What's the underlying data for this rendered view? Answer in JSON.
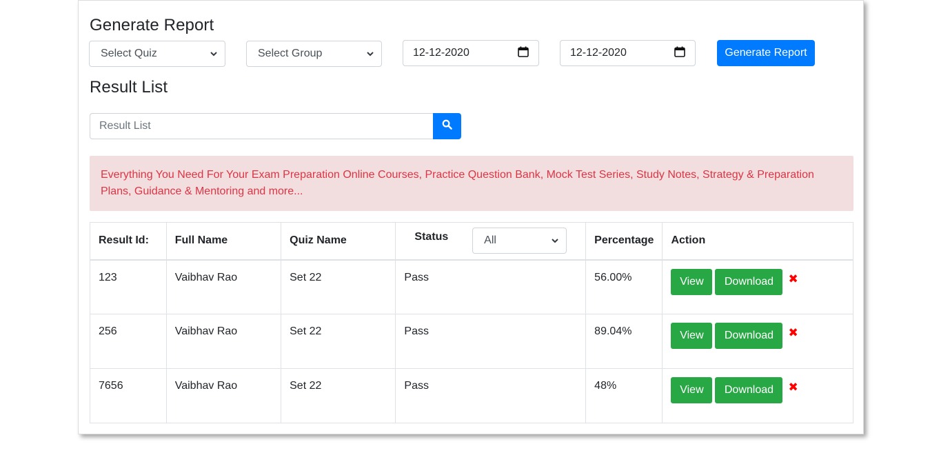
{
  "generate": {
    "title": "Generate Report",
    "quiz_select": "Select Quiz",
    "group_select": "Select Group",
    "date_from": "12-12-2020",
    "date_to": "12-12-2020",
    "button": "Generate Report"
  },
  "results": {
    "title": "Result List",
    "search_placeholder": "Result List"
  },
  "alert": {
    "text": "Everything You Need For Your Exam Preparation Online Courses, Practice Question Bank, Mock Test Series, Study Notes, Strategy & Preparation Plans, Guidance & Mentoring and more..."
  },
  "table": {
    "headers": {
      "result_id": "Result Id:",
      "full_name": "Full Name",
      "quiz_name": "Quiz Name",
      "status": "Status",
      "status_filter": "All",
      "percentage": "Percentage",
      "action": "Action"
    },
    "view_label": "View",
    "download_label": "Download",
    "delete_glyph": "✖",
    "rows": [
      {
        "id": "123",
        "name": "Vaibhav Rao",
        "quiz": "Set 22",
        "status": "Pass",
        "percentage": "56.00%"
      },
      {
        "id": "256",
        "name": "Vaibhav Rao",
        "quiz": "Set 22",
        "status": "Pass",
        "percentage": "89.04%"
      },
      {
        "id": "7656",
        "name": "Vaibhav Rao",
        "quiz": "Set 22",
        "status": "Pass",
        "percentage": "48%"
      }
    ]
  },
  "colors": {
    "primary": "#007bff",
    "success": "#28a745",
    "alert_bg": "#f2dede",
    "alert_text": "#dc3545",
    "delete": "#ff0000"
  },
  "icons": {
    "search": "search-icon",
    "calendar": "calendar-icon",
    "dropdown": "chevron-down-icon",
    "delete": "close-icon"
  }
}
